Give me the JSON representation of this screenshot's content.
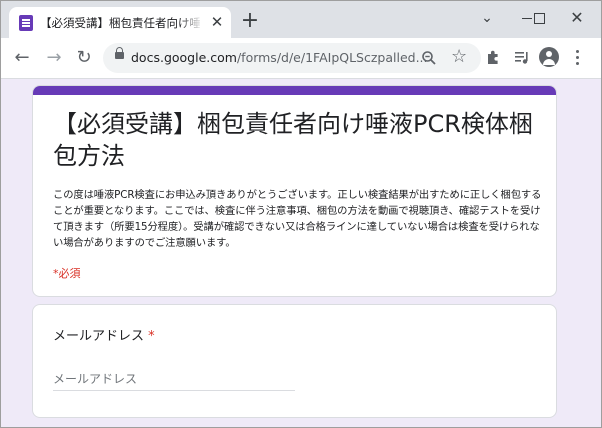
{
  "browser": {
    "tab_title": "【必須受講】梱包責任者向け唾液PCR検体梱包方法 - Google フォーム",
    "tab_close": "✕",
    "new_tab": "+",
    "url_host": "docs.google.com",
    "url_path": "/forms/d/e/1FAIpQLSczpalled...",
    "window_controls": {
      "dropdown": "⌄",
      "close": "✕"
    }
  },
  "icons": {
    "back": "←",
    "forward": "→",
    "reload": "↻",
    "star": "☆",
    "extensions": "puzzle-icon",
    "media": "media-list-icon"
  },
  "form": {
    "accent_color": "#673ab7",
    "background_color": "#efeaf8",
    "title": "【必須受講】梱包責任者向け唾液PCR検体梱包方法",
    "description": "この度は唾液PCR検査にお申込み頂きありがとうございます。正しい検査結果が出すために正しく梱包することが重要となります。ここでは、検査に伴う注意事項、梱包の方法を動画で視聴頂き、確認テストを受けて頂きます（所要15分程度）。受講が確認できない又は合格ラインに達していない場合は検査を受けられない場合がありますのでご注意願います。",
    "required_note": "*必須"
  },
  "question": {
    "label": "メールアドレス",
    "required_mark": "*",
    "placeholder": "メールアドレス",
    "value": ""
  }
}
